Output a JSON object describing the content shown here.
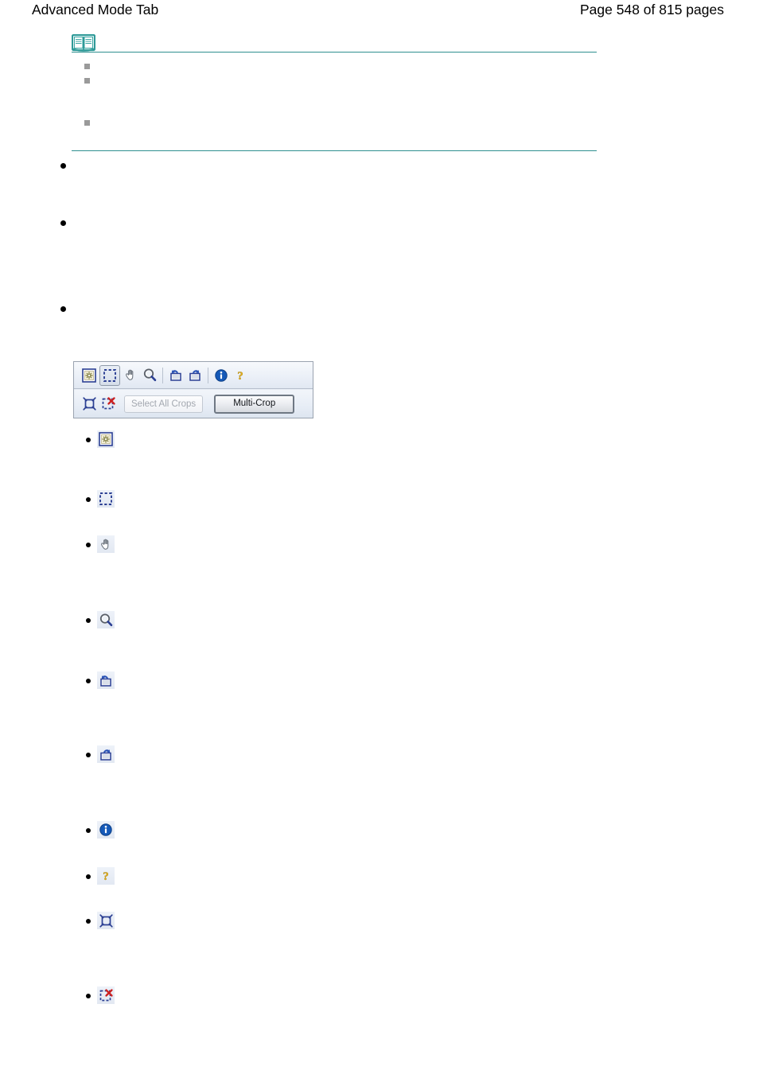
{
  "header": {
    "left_title": "Advanced Mode Tab",
    "right_page_info": "Page 548 of 815 pages"
  },
  "note_box": {
    "icon_name": "open-book-icon",
    "rule_color": "#2f8f8f",
    "bullets": [
      "",
      "",
      ""
    ]
  },
  "body_bullets": [
    "",
    "",
    ""
  ],
  "toolbar": {
    "row1": [
      {
        "name": "auto-crop-icon",
        "label": "",
        "state": "normal"
      },
      {
        "name": "crop-selection-icon",
        "label": "",
        "state": "pressed"
      },
      {
        "name": "move-hand-icon",
        "label": "",
        "state": "normal"
      },
      {
        "name": "zoom-magnifier-icon",
        "label": "",
        "state": "normal"
      },
      {
        "name": "rotate-left-icon",
        "label": "",
        "state": "normal"
      },
      {
        "name": "rotate-right-icon",
        "label": "",
        "state": "normal"
      },
      {
        "name": "information-icon",
        "label": "",
        "state": "normal"
      },
      {
        "name": "help-question-icon",
        "label": "",
        "state": "normal"
      }
    ],
    "row2": {
      "icons": [
        {
          "name": "select-all-crops-icon",
          "label": ""
        },
        {
          "name": "clear-crop-icon",
          "label": ""
        }
      ],
      "select_all_crops_label": "Select All Crops",
      "select_all_crops_state": "disabled",
      "multi_crop_label": "Multi-Crop",
      "multi_crop_state": "default"
    }
  },
  "legend": [
    {
      "icon": "auto-crop-icon",
      "label": ""
    },
    {
      "icon": "crop-selection-icon",
      "label": ""
    },
    {
      "icon": "move-hand-icon",
      "label": ""
    },
    {
      "icon": "zoom-magnifier-icon",
      "label": ""
    },
    {
      "icon": "rotate-left-icon",
      "label": ""
    },
    {
      "icon": "rotate-right-icon",
      "label": ""
    },
    {
      "icon": "information-icon",
      "label": ""
    },
    {
      "icon": "help-question-icon",
      "label": ""
    },
    {
      "icon": "select-all-crops-icon",
      "label": ""
    },
    {
      "icon": "clear-crop-icon",
      "label": ""
    }
  ],
  "colors": {
    "rule_teal": "#2f8f8f",
    "icon_blue": "#2b3f93",
    "info_blue": "#1559b8",
    "help_gold": "#e3ae20",
    "square_bullet_gray": "#9a9a9a"
  }
}
